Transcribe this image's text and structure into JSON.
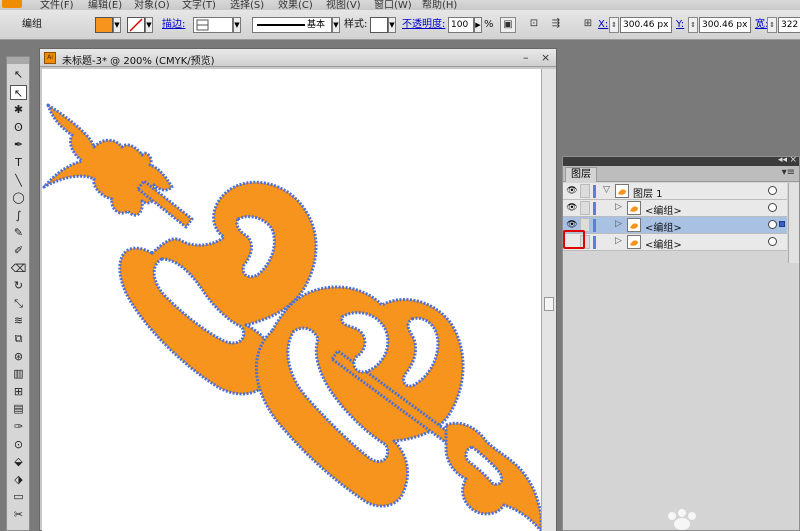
{
  "menu": {
    "items": [
      "文件(F)",
      "编辑(E)",
      "对象(O)",
      "文字(T)",
      "选择(S)",
      "效果(C)",
      "视图(V)",
      "窗口(W)",
      "帮助(H)"
    ]
  },
  "controlbar": {
    "selection_label": "编组",
    "stroke_label": "描边:",
    "stroke_profile": "基本",
    "style_label": "样式:",
    "opacity_label": "不透明度:",
    "opacity_value": "100",
    "opacity_unit": "%",
    "x_label": "X:",
    "x_value": "300.46 px",
    "y_label": "Y:",
    "y_value": "300.46 px",
    "width_label": "宽:",
    "width_value": "322",
    "fill_color": "#f7941d"
  },
  "document": {
    "title": "未标题-3* @ 200% (CMYK/预览)",
    "icon_text": "Ai",
    "art_fill": "#f7941d",
    "art_stroke": "#4a6fd8"
  },
  "layers": {
    "tab_label": "图层",
    "rows": [
      {
        "name": "图层 1",
        "visible": true,
        "selected": false,
        "indent": 0
      },
      {
        "name": "<编组>",
        "visible": true,
        "selected": false,
        "indent": 1
      },
      {
        "name": "<编组>",
        "visible": true,
        "selected": true,
        "indent": 1
      },
      {
        "name": "<编组>",
        "visible": false,
        "selected": false,
        "indent": 1
      }
    ]
  },
  "tools": {
    "icons": [
      "selection-tool-icon",
      "direct-selection-tool-icon",
      "magic-wand-tool-icon",
      "lasso-tool-icon",
      "pen-tool-icon",
      "type-tool-icon",
      "line-tool-icon",
      "ellipse-tool-icon",
      "paintbrush-tool-icon",
      "pencil-tool-icon",
      "blob-brush-tool-icon",
      "eraser-tool-icon",
      "rotate-tool-icon",
      "scale-tool-icon",
      "warp-tool-icon",
      "free-transform-tool-icon",
      "symbol-sprayer-tool-icon",
      "column-graph-tool-icon",
      "mesh-tool-icon",
      "gradient-tool-icon",
      "eyedropper-tool-icon",
      "blend-tool-icon",
      "live-paint-tool-icon",
      "live-paint-select-tool-icon",
      "artboard-tool-icon",
      "slice-tool-icon"
    ]
  }
}
